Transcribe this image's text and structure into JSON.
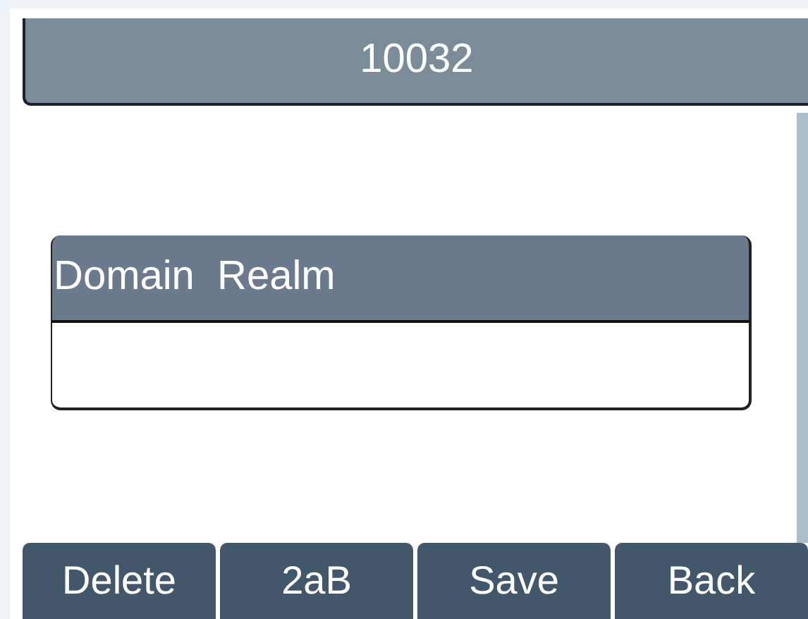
{
  "title": "10032",
  "field": {
    "label": "Domain  Realm"
  },
  "softkeys": [
    "Delete",
    "2aB",
    "Save",
    "Back"
  ]
}
